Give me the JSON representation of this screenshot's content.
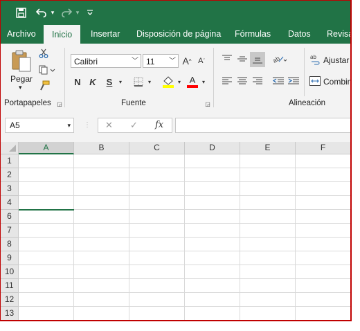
{
  "qat": {
    "save_icon": "save-icon",
    "undo_icon": "undo-icon",
    "redo_icon": "redo-icon",
    "customize_icon": "customize-icon"
  },
  "tabs": [
    "Archivo",
    "Inicio",
    "Insertar",
    "Disposición de página",
    "Fórmulas",
    "Datos",
    "Revisar"
  ],
  "active_tab": "Inicio",
  "ribbon": {
    "paste_label": "Pegar",
    "clipboard_group": "Portapapeles",
    "font_group": "Fuente",
    "alignment_group": "Alineación",
    "font_name": "Calibri",
    "font_size": "11",
    "bold": "N",
    "italic": "K",
    "underline": "S",
    "font_color_letter": "A",
    "grow_font": "A",
    "shrink_font": "A",
    "wrap_text_label": "Ajustar t",
    "merge_label": "Combin",
    "highlight_color": "#ffff00",
    "font_color": "#ff0000"
  },
  "formula_bar": {
    "name_box": "A5",
    "fx": "fx",
    "cancel": "✕",
    "enter": "✓",
    "value": ""
  },
  "columns": [
    "A",
    "B",
    "C",
    "D",
    "E",
    "F"
  ],
  "rows": [
    "1",
    "2",
    "3",
    "4",
    "6",
    "7",
    "8",
    "9",
    "10",
    "11",
    "12",
    "13"
  ],
  "colors": {
    "brand": "#217346",
    "border_frame": "#c00000"
  }
}
